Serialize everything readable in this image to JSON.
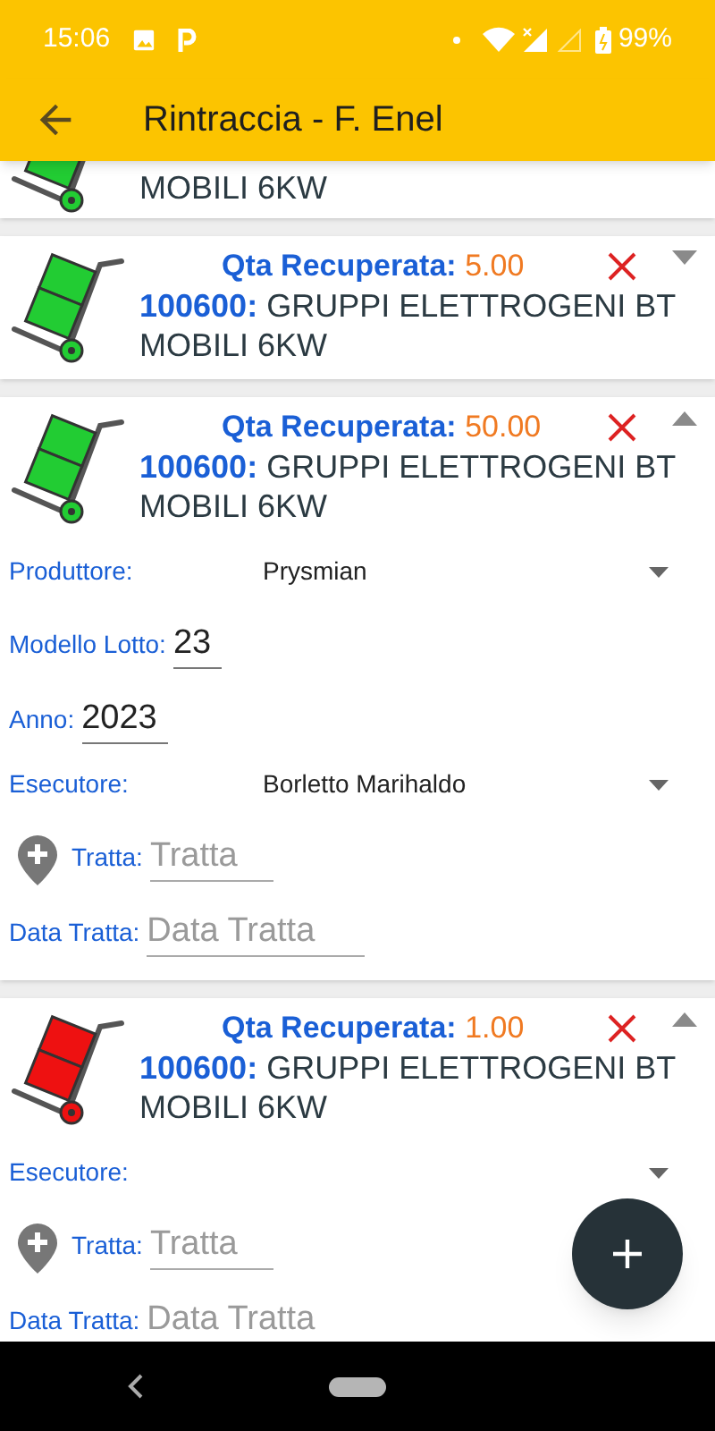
{
  "status_bar": {
    "time": "15:06",
    "battery": "99%"
  },
  "toolbar": {
    "title": "Rintraccia - F. Enel"
  },
  "cards": [
    {
      "kind": "partial",
      "color": "#22cc33",
      "text": "MOBILI 6KW"
    },
    {
      "kind": "item",
      "color": "#22cc33",
      "expanded": false,
      "qty_label": "Qta Recuperata:",
      "qty": "5.00",
      "code": "100600:",
      "description": "GRUPPI ELETTROGENI BT MOBILI 6KW"
    },
    {
      "kind": "item",
      "color": "#22cc33",
      "expanded": true,
      "qty_label": "Qta Recuperata:",
      "qty": "50.00",
      "code": "100600:",
      "description": "GRUPPI ELETTROGENI BT MOBILI 6KW",
      "fields": [
        {
          "kind": "dropdown",
          "label": "Produttore:",
          "value": "Prysmian"
        },
        {
          "kind": "input",
          "label": "Modello Lotto:",
          "value": "23"
        },
        {
          "kind": "input",
          "label": "Anno:",
          "value": "2023"
        },
        {
          "kind": "dropdown",
          "label": "Esecutore:",
          "value": "Borletto Marihaldo"
        },
        {
          "kind": "location",
          "label": "Tratta:",
          "placeholder": "Tratta"
        },
        {
          "kind": "input",
          "label": "Data Tratta:",
          "placeholder": "Data Tratta"
        }
      ]
    },
    {
      "kind": "item",
      "color": "#ee1111",
      "expanded": true,
      "qty_label": "Qta Recuperata:",
      "qty": "1.00",
      "code": "100600:",
      "description": "GRUPPI ELETTROGENI BT MOBILI 6KW",
      "fields": [
        {
          "kind": "dropdown",
          "label": "Esecutore:"
        },
        {
          "kind": "location",
          "label": "Tratta:",
          "placeholder": "Tratta"
        },
        {
          "kind": "input",
          "label": "Data Tratta:",
          "placeholder": "Data Tratta"
        }
      ]
    }
  ]
}
